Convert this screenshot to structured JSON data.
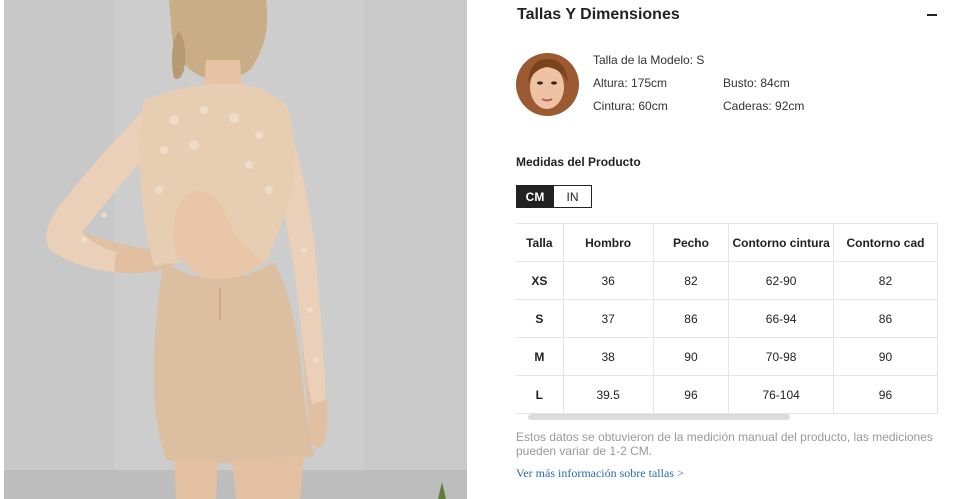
{
  "section": {
    "title": "Tallas Y Dimensiones",
    "collapse_icon": "minus-icon"
  },
  "model": {
    "size_label": "Talla de la Modelo: S",
    "height": "Altura: 175cm",
    "bust": "Busto: 84cm",
    "waist": "Cintura: 60cm",
    "hips": "Caderas: 92cm"
  },
  "measurements": {
    "title": "Medidas del Producto",
    "units": [
      "CM",
      "IN"
    ],
    "active_unit": "CM"
  },
  "table": {
    "headers": [
      "Talla",
      "Hombro",
      "Pecho",
      "Contorno cintura",
      "Contorno cad"
    ],
    "rows": [
      [
        "XS",
        "36",
        "82",
        "62-90",
        "82"
      ],
      [
        "S",
        "37",
        "86",
        "66-94",
        "86"
      ],
      [
        "M",
        "38",
        "90",
        "70-98",
        "90"
      ],
      [
        "L",
        "39.5",
        "96",
        "76-104",
        "96"
      ]
    ]
  },
  "footer": {
    "note": "Estos datos se obtuvieron de la medición manual del producto, las mediciones pueden variar de 1-2 CM.",
    "more_link": "Ver más información sobre tallas >"
  },
  "colors": {
    "dress": "#dcbfa0",
    "lace": "#e8cfb4",
    "link": "#2a6ab3",
    "accent_dark": "#222222"
  }
}
